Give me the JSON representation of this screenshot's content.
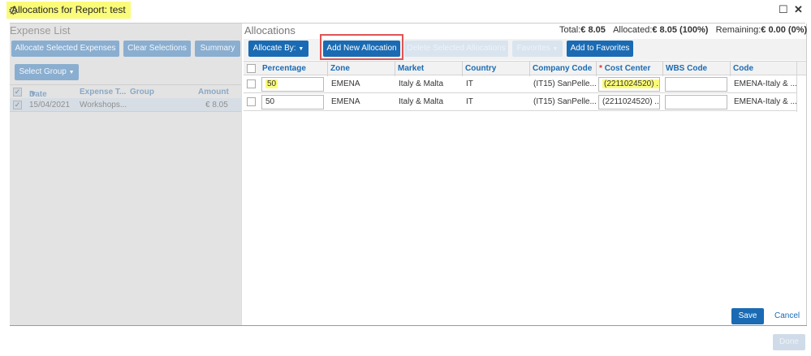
{
  "window": {
    "title": "Allocations for Report: test"
  },
  "expense_list": {
    "title": "Expense List",
    "buttons": {
      "allocate_selected": "Allocate Selected Expenses",
      "clear_selections": "Clear Selections",
      "summary": "Summary",
      "select_group": "Select Group"
    },
    "columns": {
      "date": "Date",
      "expense_type": "Expense T...",
      "group": "Group",
      "amount": "Amount"
    },
    "rows": [
      {
        "date": "15/04/2021",
        "expense_type": "Workshops...",
        "group": "",
        "amount": "€ 8.05"
      }
    ]
  },
  "allocations": {
    "title": "Allocations",
    "totals": {
      "total_label": "Total:",
      "total_value": "€ 8.05",
      "allocated_label": "Allocated:",
      "allocated_value": "€ 8.05 (100%)",
      "remaining_label": "Remaining:",
      "remaining_value": "€ 0.00 (0%)"
    },
    "toolbar": {
      "allocate_by": "Allocate By:",
      "add_new_allocation": "Add New Allocation",
      "delete_selected": "Delete Selected Allocations",
      "favorites": "Favorites",
      "add_to_favorites": "Add to Favorites"
    },
    "columns": {
      "percentage": "Percentage",
      "zone": "Zone",
      "market": "Market",
      "country": "Country",
      "company_code": "Company Code",
      "cost_center_required": "*",
      "cost_center": "Cost Center",
      "wbs_code": "WBS Code",
      "code": "Code"
    },
    "rows": [
      {
        "percentage": "50",
        "zone": "EMENA",
        "market": "Italy & Malta",
        "country": "IT",
        "company_code": "(IT15) SanPelle...",
        "cost_center": "(2211024520) ...",
        "wbs_code": "",
        "code": "EMENA-Italy & ..."
      },
      {
        "percentage": "50",
        "zone": "EMENA",
        "market": "Italy & Malta",
        "country": "IT",
        "company_code": "(IT15) SanPelle...",
        "cost_center": "(2211024520) ...",
        "wbs_code": "",
        "code": "EMENA-Italy & ..."
      }
    ],
    "save": "Save",
    "cancel": "Cancel"
  },
  "done": "Done",
  "icons": {
    "title_icon": "gear-icon",
    "maximize": "maximize-icon",
    "close": "close-icon",
    "sort": "sort-down-icon",
    "dropdown": "chevron-down-icon"
  },
  "colors": {
    "primary": "#1a6bb3",
    "highlight": "#fbfb7a",
    "disabled": "#8aaed0",
    "annotation": "#e05454"
  }
}
